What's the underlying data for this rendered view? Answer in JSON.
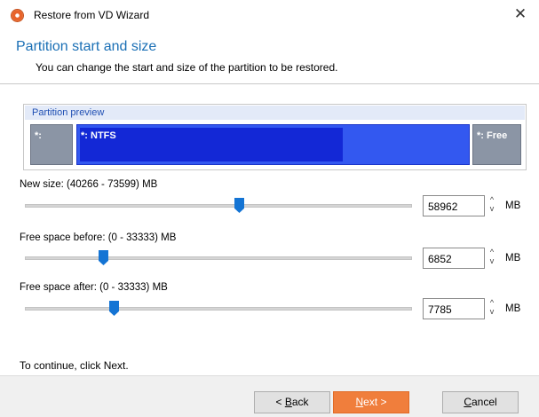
{
  "window": {
    "title": "Restore from VD Wizard",
    "close_glyph": "✕"
  },
  "header": {
    "title": "Partition start and size",
    "subtitle": "You can change the start and size of the partition to be restored."
  },
  "preview": {
    "caption": "Partition preview",
    "segments": {
      "left": "*:",
      "main": "*: NTFS",
      "right": "*: Free"
    },
    "colors": {
      "main": "#3358f0",
      "used": "#1328d6",
      "side": "#8b95a5"
    }
  },
  "fields": {
    "new_size": {
      "label": "New size: (40266 - 73599) MB",
      "value": "58962",
      "unit": "MB"
    },
    "free_before": {
      "label": "Free space before: (0 - 33333) MB",
      "value": "6852",
      "unit": "MB"
    },
    "free_after": {
      "label": "Free space after: (0 - 33333) MB",
      "value": "7785",
      "unit": "MB"
    }
  },
  "spin_glyphs": {
    "up": "^",
    "down": "v"
  },
  "instruction": "To continue, click Next.",
  "buttons": {
    "back_prefix": "< ",
    "back_access": "B",
    "back_rest": "ack",
    "next_access": "N",
    "next_rest": "ext >",
    "cancel_access": "C",
    "cancel_rest": "ancel"
  },
  "accent_color": "#f07e3c",
  "thumb_color": "#1474d4"
}
